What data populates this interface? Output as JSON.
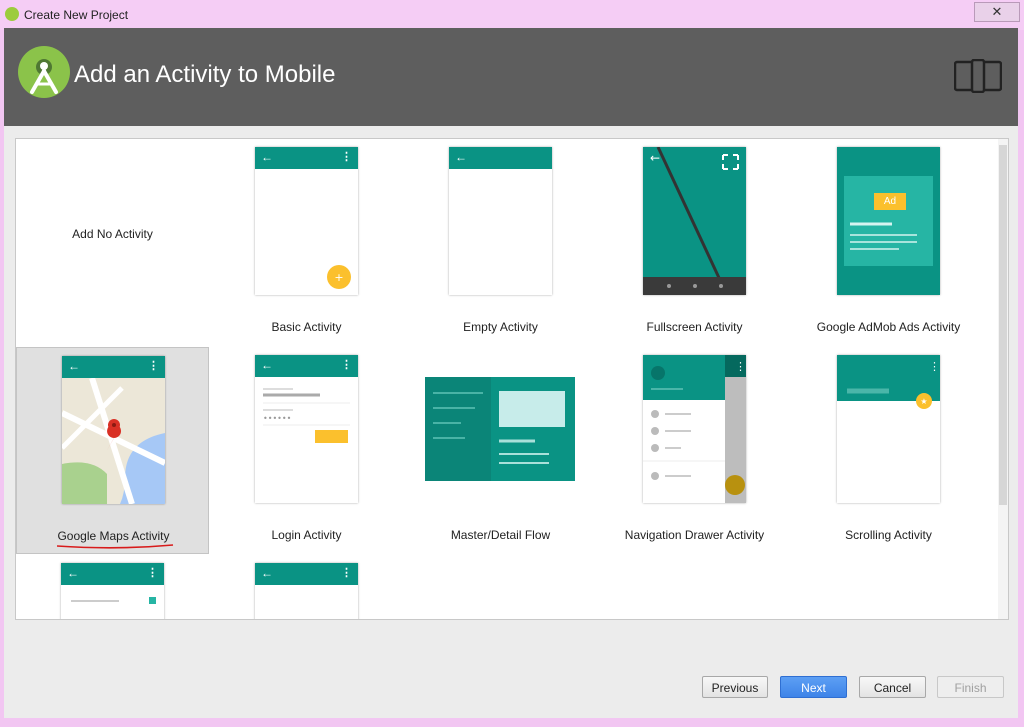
{
  "window": {
    "title": "Create New Project",
    "close_glyph": "✕"
  },
  "header": {
    "title": "Add an Activity to Mobile",
    "logo_icon": "android-studio-icon",
    "device_icon": "phone-tablet-icon"
  },
  "gallery": {
    "tiles": [
      {
        "label": "Add No Activity"
      },
      {
        "label": "Basic Activity"
      },
      {
        "label": "Empty Activity"
      },
      {
        "label": "Fullscreen Activity"
      },
      {
        "label": "Google AdMob Ads Activity",
        "ad_badge": "Ad"
      },
      {
        "label": "Google Maps Activity",
        "selected": true
      },
      {
        "label": "Login Activity"
      },
      {
        "label": "Master/Detail Flow"
      },
      {
        "label": "Navigation Drawer Activity"
      },
      {
        "label": "Scrolling Activity"
      }
    ]
  },
  "buttons": {
    "previous": "Previous",
    "next": "Next",
    "cancel": "Cancel",
    "finish": "Finish"
  },
  "colors": {
    "teal": "#0a9384",
    "header_bg": "#5e5e5e",
    "accent_yellow": "#fbc02d",
    "next_blue": "#3e84e8"
  }
}
